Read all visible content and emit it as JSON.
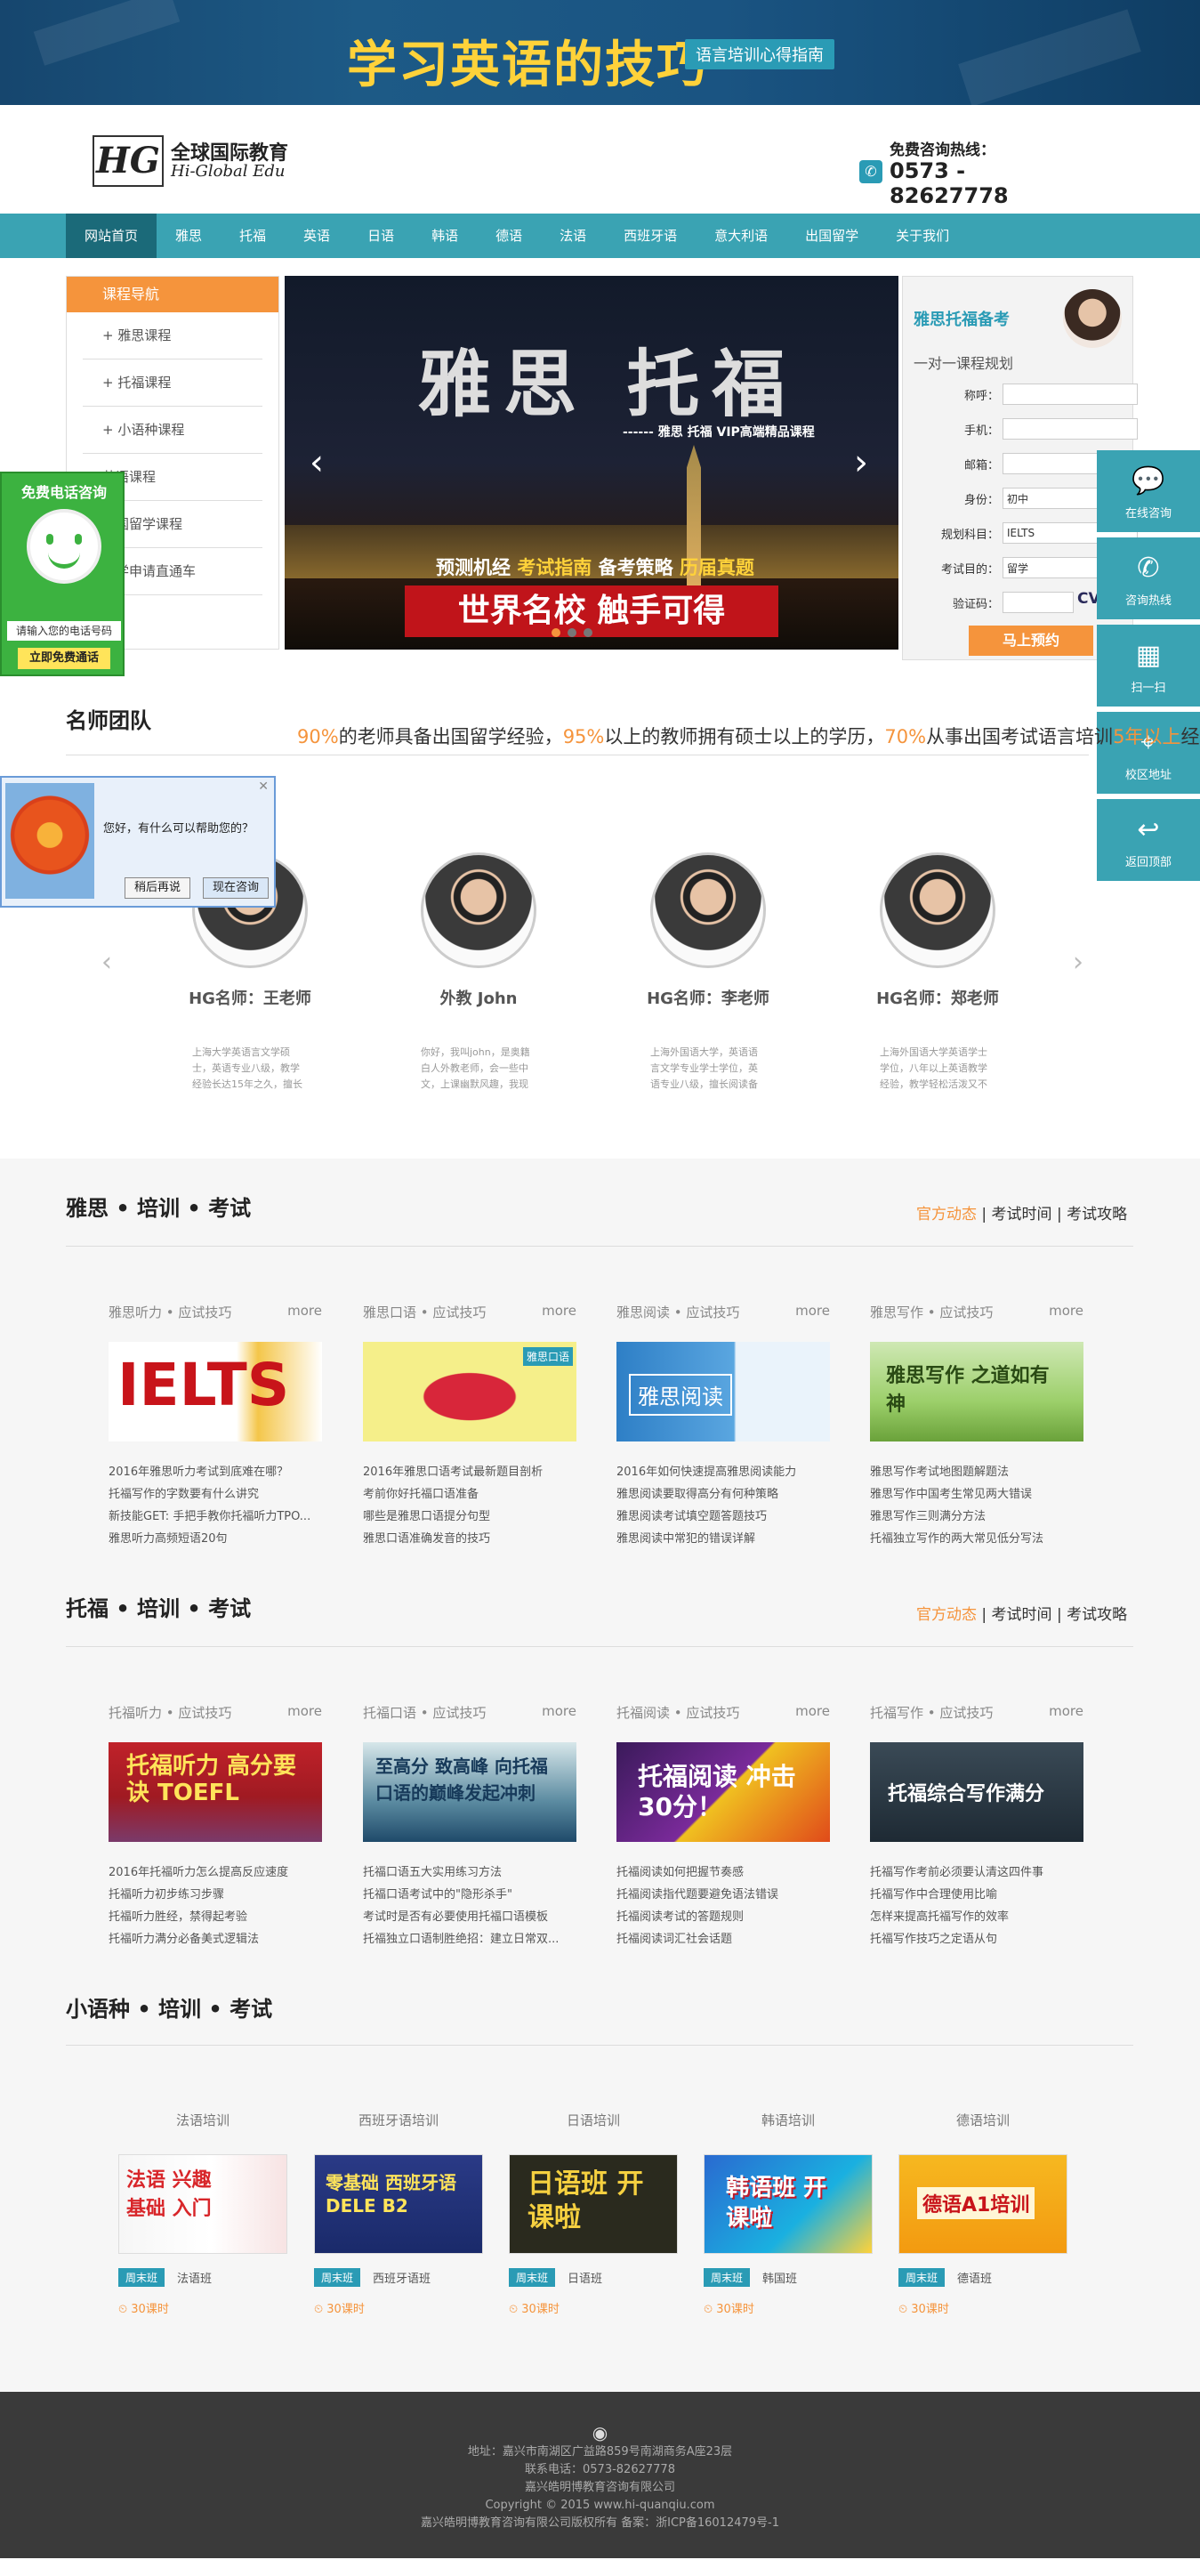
{
  "banner": {
    "title": "学习英语的技巧",
    "tag": "语言培训心得指南"
  },
  "logo": {
    "mark": "HG",
    "cn": "全球国际教育",
    "en": "Hi-Global Edu"
  },
  "hotline": {
    "label": "免费咨询热线：",
    "number": "0573 - 82627778"
  },
  "nav": [
    "网站首页",
    "雅思",
    "托福",
    "英语",
    "日语",
    "韩语",
    "德语",
    "法语",
    "西班牙语",
    "意大利语",
    "出国留学",
    "关于我们"
  ],
  "course_nav": {
    "title": "课程导航",
    "items": [
      "+ 雅思课程",
      "+ 托福课程",
      "+ 小语种课程",
      "英语课程",
      "出国留学课程",
      "留学申请直通车"
    ]
  },
  "slider": {
    "big": "雅思  托福",
    "sub": "------ 雅思 托福 VIP高端精品课程",
    "tagline_a": "预测机经",
    "tagline_b": "考试指南",
    "tagline_c": "备考策略",
    "tagline_d": "历届真题",
    "slogan": "世界名校 触手可得"
  },
  "booking": {
    "title": "雅思托福备考",
    "subtitle": "一对一课程规划",
    "fields": [
      {
        "label": "称呼：",
        "value": ""
      },
      {
        "label": "手机：",
        "value": ""
      },
      {
        "label": "邮箱：",
        "value": ""
      },
      {
        "label": "身份：",
        "value": "初中"
      },
      {
        "label": "规划科目：",
        "value": "IELTS"
      },
      {
        "label": "考试目的：",
        "value": "留学"
      },
      {
        "label": "验证码：",
        "value": ""
      }
    ],
    "captcha": "CVS",
    "submit": "马上预约"
  },
  "left_widget": {
    "title": "免费电话咨询",
    "input": "请输入您的电话号码",
    "button": "立即免费通话"
  },
  "right_float": [
    {
      "icon": "chat-icon",
      "glyph": "💬",
      "label": "在线咨询"
    },
    {
      "icon": "phone-icon",
      "glyph": "✆",
      "label": "咨询热线"
    },
    {
      "icon": "qrcode-icon",
      "glyph": "▦",
      "label": "扫一扫"
    },
    {
      "icon": "location-icon",
      "glyph": "⌖",
      "label": "校区地址"
    },
    {
      "icon": "back-top-icon",
      "glyph": "↩",
      "label": "返回顶部"
    }
  ],
  "teachers": {
    "title": "名师团队",
    "desc_a": "90%",
    "desc_b": "的老师具备出国留学经验，",
    "desc_c": "95%",
    "desc_d": "以上的教师拥有硕士以上的学历，",
    "desc_e": "70%",
    "desc_f": "从事出国考试语言培训",
    "desc_g": "5年以上",
    "desc_h": "经",
    "cards": [
      {
        "name": "HG名师：王老师",
        "desc": "上海大学英语言文学硕士，英语专业八级，教学经验长达15年之久，擅长"
      },
      {
        "name": "外教 John",
        "desc": "你好，我叫john，是奥籍白人外教老师，会一些中文，上课幽默风趣，我现"
      },
      {
        "name": "HG名师：李老师",
        "desc": "上海外国语大学，英语语言文学专业学士学位，英语专业八级，擅长阅读备"
      },
      {
        "name": "HG名师：郑老师",
        "desc": "上海外国语大学英语学士学位，八年以上英语教学经验，教学轻松活泼又不"
      }
    ]
  },
  "popup": {
    "question": "您好，有什么可以帮助您的？",
    "later": "稍后再说",
    "now": "现在咨询"
  },
  "ielts": {
    "title": "雅思 • 培训 • 考试",
    "links_a": "官方动态",
    "links_b": " | 考试时间 | 考试攻略",
    "cols": [
      {
        "h": "雅思听力 • 应试技巧",
        "more": "more",
        "list": [
          "2016年雅思听力考试到底难在哪？",
          "托福写作的字数要有什么讲究",
          "新技能GET: 手把手教你托福听力TPO...",
          "雅思听力高频短语20句"
        ]
      },
      {
        "h": "雅思口语 • 应试技巧",
        "more": "more",
        "list": [
          "2016年雅思口语考试最新题目剖析",
          "考前你好托福口语准备",
          "哪些是雅思口语提分句型",
          "雅思口语准确发音的技巧"
        ]
      },
      {
        "h": "雅思阅读 • 应试技巧",
        "more": "more",
        "list": [
          "2016年如何快速提高雅思阅读能力",
          "雅思阅读要取得高分有何种策略",
          "雅思阅读考试填空题答题技巧",
          "雅思阅读中常犯的错误详解"
        ]
      },
      {
        "h": "雅思写作 • 应试技巧",
        "more": "more",
        "list": [
          "雅思写作考试地图题解题法",
          "雅思写作中国考生常见两大错误",
          "雅思写作三则满分方法",
          "托福独立写作的两大常见低分写法"
        ]
      }
    ]
  },
  "toefl": {
    "title": "托福 • 培训 • 考试",
    "links_a": "官方动态",
    "links_b": " | 考试时间 | 考试攻略",
    "cols": [
      {
        "h": "托福听力 • 应试技巧",
        "more": "more",
        "list": [
          "2016年托福听力怎么提高反应速度",
          "托福听力初步练习步骤",
          "托福听力胜经，禁得起考验",
          "托福听力满分必备美式逻辑法"
        ]
      },
      {
        "h": "托福口语 • 应试技巧",
        "more": "more",
        "list": [
          "托福口语五大实用练习方法",
          "托福口语考试中的\"隐形杀手\"",
          "考试时是否有必要使用托福口语模板",
          "托福独立口语制胜绝招：建立日常双..."
        ]
      },
      {
        "h": "托福阅读 • 应试技巧",
        "more": "more",
        "list": [
          "托福阅读如何把握节奏感",
          "托福阅读指代题要避免语法错误",
          "托福阅读考试的答题规则",
          "托福阅读词汇社会话题"
        ]
      },
      {
        "h": "托福写作 • 应试技巧",
        "more": "more",
        "list": [
          "托福写作考前必须要认清这四件事",
          "托福写作中合理使用比喻",
          "怎样来提高托福写作的效率",
          "托福写作技巧之定语从句"
        ]
      }
    ]
  },
  "minor": {
    "title": "小语种 • 培训 • 考试",
    "cards": [
      {
        "t": "法语培训",
        "tag": "周末班",
        "name": "法语班",
        "hours": "30课时"
      },
      {
        "t": "西班牙语培训",
        "tag": "周末班",
        "name": "西班牙语班",
        "hours": "30课时"
      },
      {
        "t": "日语培训",
        "tag": "周末班",
        "name": "日语班",
        "hours": "30课时"
      },
      {
        "t": "韩语培训",
        "tag": "周末班",
        "name": "韩国班",
        "hours": "30课时"
      },
      {
        "t": "德语培训",
        "tag": "周末班",
        "name": "德语班",
        "hours": "30课时"
      }
    ]
  },
  "images": {
    "ielts": [
      "IELTS",
      "雅思口语",
      "雅思阅读",
      "雅思写作 之道如有神"
    ],
    "toefl": [
      "托福听力 高分要诀 TOEFL",
      "至高分 致高峰 向托福口语的巅峰发起冲刺",
      "托福阅读 冲击30分！",
      "托福综合写作满分"
    ],
    "minor": [
      "法语 兴趣基础 入门",
      "零基础 西班牙语 DELE B2",
      "日语班 开课啦",
      "韩语班 开课啦",
      "德语A1培训"
    ]
  },
  "footer": {
    "addr": "地址：嘉兴市南湖区广益路859号南湖商务A座23层",
    "tel": "联系电话：0573-82627778",
    "co": "嘉兴皓明博教育咨询有限公司",
    "copy": "Copyright © 2015 www.hi-quanqiu.com",
    "icp": "嘉兴皓明博教育咨询有限公司版权所有 备案：浙ICP备16012479号-1"
  }
}
